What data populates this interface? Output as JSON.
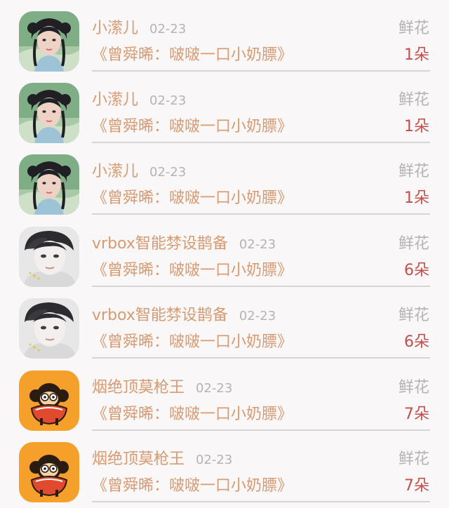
{
  "rows": [
    {
      "avatar": "girl-portrait",
      "name": "小潆儿",
      "date": "02-23",
      "gift_label": "鲜花",
      "message": "《曾舜晞：啵啵一口小奶膘》",
      "count": "1朵"
    },
    {
      "avatar": "girl-portrait",
      "name": "小潆儿",
      "date": "02-23",
      "gift_label": "鲜花",
      "message": "《曾舜晞：啵啵一口小奶膘》",
      "count": "1朵"
    },
    {
      "avatar": "girl-portrait",
      "name": "小潆儿",
      "date": "02-23",
      "gift_label": "鲜花",
      "message": "《曾舜晞：啵啵一口小奶膘》",
      "count": "1朵"
    },
    {
      "avatar": "boy-portrait",
      "name": "vrbox智能棼设鹊备",
      "date": "02-23",
      "gift_label": "鲜花",
      "message": "《曾舜晞：啵啵一口小奶膘》",
      "count": "6朵"
    },
    {
      "avatar": "boy-portrait",
      "name": "vrbox智能棼设鹊备",
      "date": "02-23",
      "gift_label": "鲜花",
      "message": "《曾舜晞：啵啵一口小奶膘》",
      "count": "6朵"
    },
    {
      "avatar": "monkey-cartoon",
      "name": "烟绝顶莫枪王",
      "date": "02-23",
      "gift_label": "鲜花",
      "message": "《曾舜晞：啵啵一口小奶膘》",
      "count": "7朵"
    },
    {
      "avatar": "monkey-cartoon",
      "name": "烟绝顶莫枪王",
      "date": "02-23",
      "gift_label": "鲜花",
      "message": "《曾舜晞：啵啵一口小奶膘》",
      "count": "7朵"
    }
  ],
  "colors": {
    "background": "#f9f7f8",
    "name_text": "#d89a70",
    "message_text": "#d89a70",
    "date_text": "#b4b4b4",
    "gift_label_text": "#b4b4b4",
    "count_text": "#c0504d",
    "divider": "#d6d6d6",
    "monkey_avatar_bg": "#f6a02c"
  }
}
